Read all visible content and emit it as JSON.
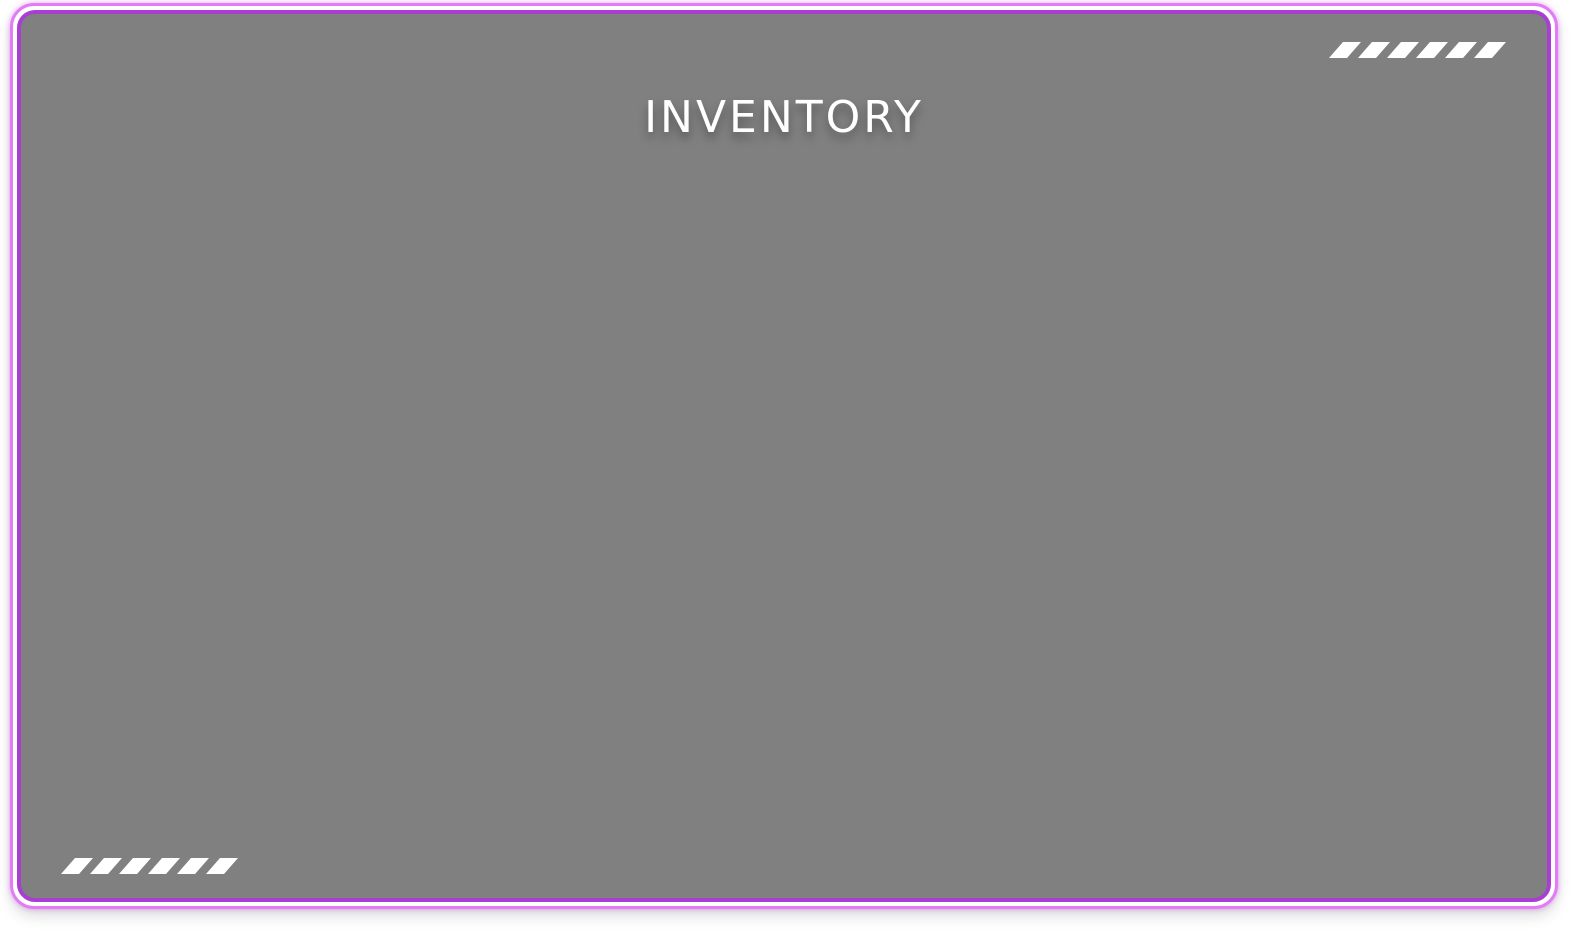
{
  "screen": {
    "title": "INVENTORY"
  },
  "colors": {
    "panel_background": "#808080",
    "border_outer": "#e27bf5",
    "border_inner": "#a83fd0",
    "title_text": "#ffffff",
    "stripe": "#ffffff"
  },
  "decorations": {
    "stripe_count": 6
  }
}
